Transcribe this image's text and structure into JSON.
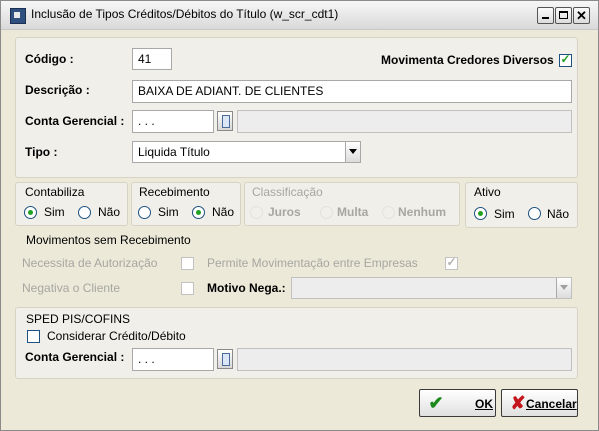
{
  "window": {
    "title": "Inclusão de Tipos Créditos/Débitos do Título (w_scr_cdt1)"
  },
  "codigo": {
    "label": "Código :",
    "value": "41"
  },
  "movimenta": {
    "label": "Movimenta Credores Diversos",
    "checked": true
  },
  "descricao": {
    "label": "Descrição :",
    "value": "BAIXA DE ADIANT. DE CLIENTES"
  },
  "conta_gerencial": {
    "label": "Conta Gerencial :",
    "value": ". . .",
    "description": ""
  },
  "tipo": {
    "label": "Tipo :",
    "value": "Liquida Título"
  },
  "contabiliza": {
    "label": "Contabiliza",
    "options": [
      "Sim",
      "Não"
    ],
    "selected": "Sim"
  },
  "recebimento": {
    "label": "Recebimento",
    "options": [
      "Sim",
      "Não"
    ],
    "selected": "Não"
  },
  "classificacao": {
    "label": "Classificação",
    "options": [
      "Juros",
      "Multa",
      "Nenhum"
    ],
    "disabled": true
  },
  "ativo": {
    "label": "Ativo",
    "options": [
      "Sim",
      "Não"
    ],
    "selected": "Sim"
  },
  "movimentos": {
    "label": "Movimentos sem Recebimento",
    "necessita_label": "Necessita de Autorização",
    "permite_label": "Permite Movimentação entre Empresas",
    "negativa_label": "Negativa o Cliente",
    "motivo_label": "Motivo Nega.:",
    "motivo_value": ""
  },
  "sped": {
    "label": "SPED PIS/COFINS",
    "considerar_label": "Considerar Crédito/Débito",
    "conta_label": "Conta Gerencial :",
    "conta_value": ". . .",
    "conta_description": ""
  },
  "buttons": {
    "ok": "OK",
    "cancelar": "Cancelar"
  },
  "colors": {
    "check_green": "#21a121",
    "dialog_bg": "#ece9d8"
  }
}
